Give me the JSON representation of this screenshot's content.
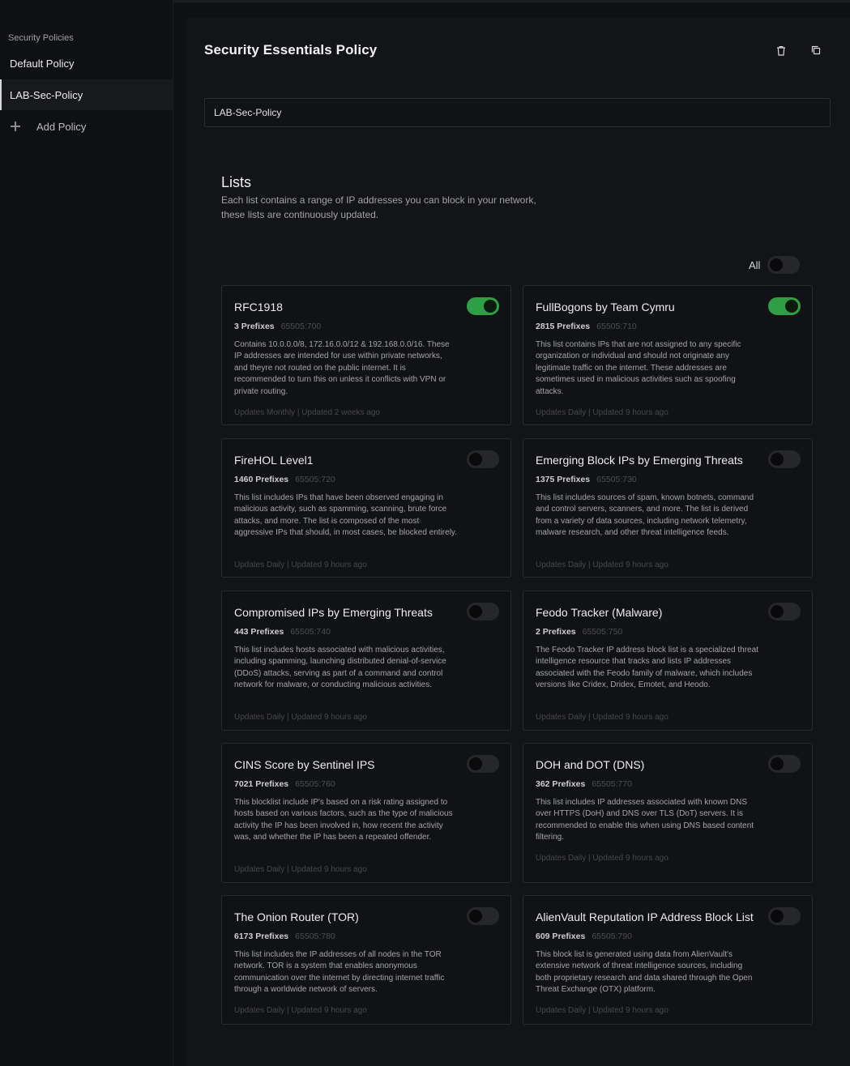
{
  "sidebar": {
    "heading": "Security Policies",
    "items": [
      {
        "label": "Default Policy"
      },
      {
        "label": "LAB-Sec-Policy"
      }
    ],
    "add_label": "Add Policy"
  },
  "header": {
    "title": "Security Essentials Policy",
    "policy_name": "LAB-Sec-Policy"
  },
  "lists": {
    "title": "Lists",
    "description": "Each list contains a range of IP addresses you can block in your network, these lists are continuously updated.",
    "all_label": "All",
    "all_enabled": false,
    "cards": [
      {
        "title": "RFC1918",
        "prefixes": "3 Prefixes",
        "asn": "65505:700",
        "enabled": true,
        "description": "Contains 10.0.0.0/8, 172.16.0.0/12 & 192.168.0.0/16. These IP addresses are intended for use within private networks, and theyre not routed on the public internet. It is recommended to turn this on unless it conflicts with VPN or private routing.",
        "updated": "Updates Monthly | Updated 2 weeks ago"
      },
      {
        "title": "FullBogons by Team Cymru",
        "prefixes": "2815 Prefixes",
        "asn": "65505:710",
        "enabled": true,
        "description": "This list contains IPs that are not assigned to any specific organization or individual and should not originate any legitimate traffic on the internet. These addresses are sometimes used in malicious activities such as spoofing attacks.",
        "updated": "Updates Daily | Updated 9 hours ago"
      },
      {
        "title": "FireHOL Level1",
        "prefixes": "1460 Prefixes",
        "asn": "65505:720",
        "enabled": false,
        "description": "This list includes IPs that have been observed engaging in malicious activity, such as spamming, scanning, brute force attacks, and more. The list is composed of the most aggressive IPs that should, in most cases, be blocked entirely.",
        "updated": "Updates Daily | Updated 9 hours ago"
      },
      {
        "title": "Emerging Block IPs by Emerging Threats",
        "prefixes": "1375 Prefixes",
        "asn": "65505:730",
        "enabled": false,
        "description": "This list includes sources of spam, known botnets, command and control servers, scanners, and more. The list is derived from a variety of data sources, including network telemetry, malware research, and other threat intelligence feeds.",
        "updated": "Updates Daily | Updated 9 hours ago"
      },
      {
        "title": "Compromised IPs by Emerging Threats",
        "prefixes": "443 Prefixes",
        "asn": "65505:740",
        "enabled": false,
        "description": "This list includes hosts associated with malicious activities, including spamming, launching distributed denial-of-service (DDoS) attacks, serving as part of a command and control network for malware, or conducting malicious activities.",
        "updated": "Updates Daily | Updated 9 hours ago"
      },
      {
        "title": "Feodo Tracker (Malware)",
        "prefixes": "2 Prefixes",
        "asn": "65505:750",
        "enabled": false,
        "description": "The Feodo Tracker IP address block list is a specialized threat intelligence resource that tracks and lists IP addresses associated with the Feodo family of malware, which includes versions like Cridex, Dridex, Emotet, and Heodo.",
        "updated": "Updates Daily | Updated 9 hours ago"
      },
      {
        "title": "CINS Score by Sentinel IPS",
        "prefixes": "7021 Prefixes",
        "asn": "65505:760",
        "enabled": false,
        "description": "This blocklist include IP's based on a risk rating assigned to hosts based on various factors, such as the type of malicious activity the IP has been involved in, how recent the activity was, and whether the IP has been a repeated offender.",
        "updated": "Updates Daily | Updated 9 hours ago"
      },
      {
        "title": "DOH and DOT (DNS)",
        "prefixes": "362 Prefixes",
        "asn": "65505:770",
        "enabled": false,
        "description": "This list includes IP addresses associated with known DNS over HTTPS (DoH) and DNS over TLS (DoT) servers. It is recommended to enable this when using DNS based content filtering.",
        "updated": "Updates Daily | Updated 9 hours ago"
      },
      {
        "title": "The Onion Router (TOR)",
        "prefixes": "6173 Prefixes",
        "asn": "65505:780",
        "enabled": false,
        "description": "This list includes the IP addresses of all nodes in the TOR network. TOR is a system that enables anonymous communication over the internet by directing internet traffic through a worldwide network of servers.",
        "updated": "Updates Daily | Updated 9 hours ago"
      },
      {
        "title": "AlienVault Reputation IP Address Block List",
        "prefixes": "609 Prefixes",
        "asn": "65505:790",
        "enabled": false,
        "description": "This block list is generated using data from AlienVault's extensive network of threat intelligence sources, including both proprietary research and data shared through the Open Threat Exchange (OTX) platform.",
        "updated": "Updates Daily | Updated 9 hours ago"
      }
    ]
  }
}
